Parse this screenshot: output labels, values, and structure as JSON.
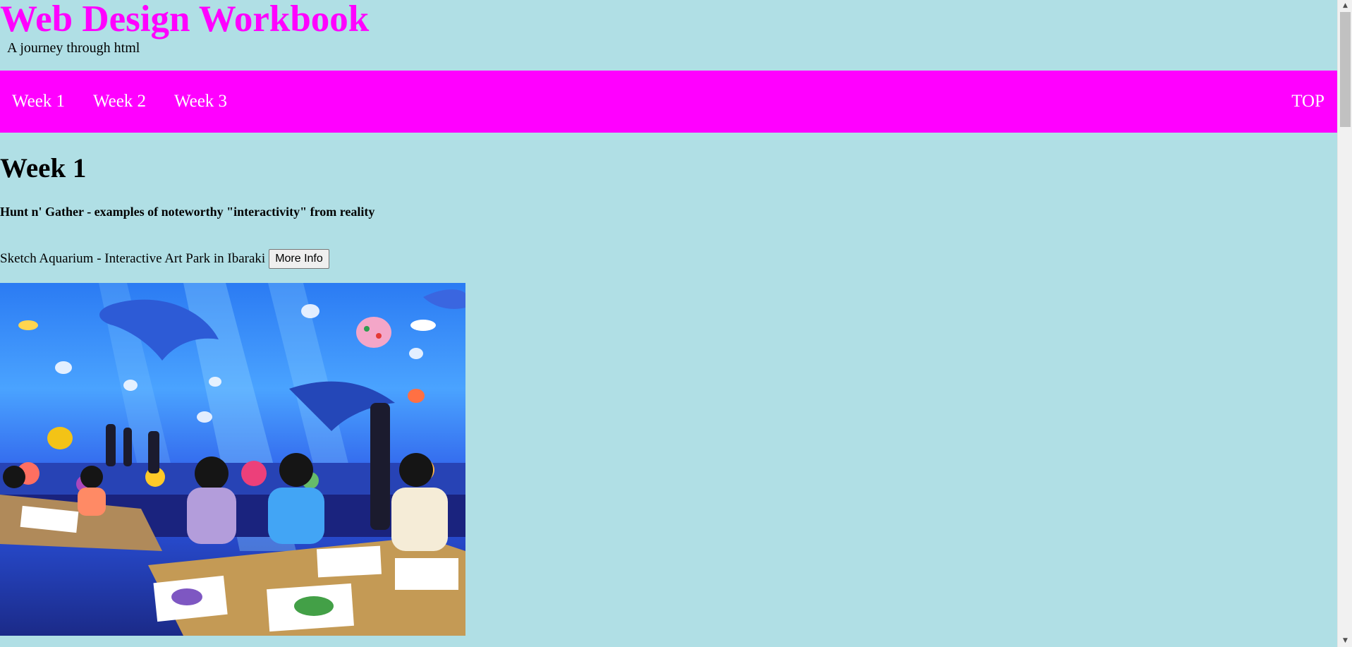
{
  "header": {
    "title": "Web Design Workbook",
    "subtitle": "A journey through html"
  },
  "nav": {
    "links": [
      {
        "label": "Week 1"
      },
      {
        "label": "Week 2"
      },
      {
        "label": "Week 3"
      }
    ],
    "top_label": "TOP"
  },
  "section": {
    "title": "Week 1",
    "subtitle": "Hunt n' Gather - examples of noteworthy \"interactivity\" from reality",
    "example": {
      "label": "Sketch Aquarium - Interactive Art Park in Ibaraki",
      "button_label": "More Info"
    }
  },
  "scrollbar": {
    "up_icon": "triangle-up-icon",
    "down_icon": "triangle-down-icon"
  },
  "colors": {
    "page_background": "#b0dfe5",
    "accent": "#ff00ff",
    "nav_text": "#ffffff"
  }
}
